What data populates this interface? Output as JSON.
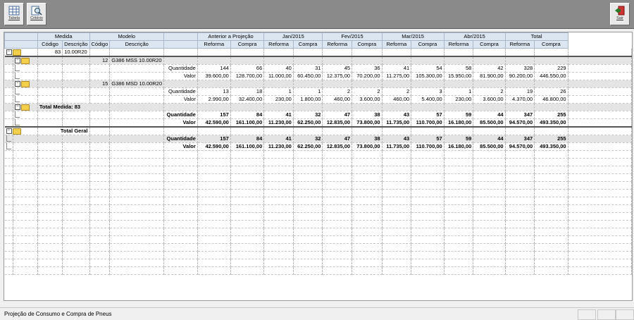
{
  "toolbar": {
    "tabela_label": "Tabela",
    "criterio_label": "Critério",
    "sair_label": "Sair"
  },
  "status": {
    "text": "Projeção de Consumo e Compra de Pneus"
  },
  "header": {
    "medida": "Medida",
    "modelo": "Modelo",
    "anterior": "Anterior a Projeção",
    "jan": "Jan/2015",
    "fev": "Fev/2015",
    "mar": "Mar/2015",
    "abr": "Abr/2015",
    "total": "Total",
    "codigo": "Código",
    "descricao": "Descrição",
    "reforma": "Reforma",
    "compra": "Compra"
  },
  "medida": {
    "codigo": "83",
    "descricao": "10.00R20"
  },
  "models": [
    {
      "codigo": "12",
      "descricao": "G386 MSS 10.00R20",
      "q": [
        "144",
        "66",
        "40",
        "31",
        "45",
        "36",
        "41",
        "54",
        "58",
        "42",
        "328",
        "229"
      ],
      "v": [
        "39.600,00",
        "128.700,00",
        "11.000,00",
        "60.450,00",
        "12.375,00",
        "70.200,00",
        "11.275,00",
        "105.300,00",
        "15.950,00",
        "81.900,00",
        "90.200,00",
        "446.550,00"
      ]
    },
    {
      "codigo": "15",
      "descricao": "G386 MSD 10.00R20",
      "q": [
        "13",
        "18",
        "1",
        "1",
        "2",
        "2",
        "2",
        "3",
        "1",
        "2",
        "19",
        "26"
      ],
      "v": [
        "2.990,00",
        "32.400,00",
        "230,00",
        "1.800,00",
        "460,00",
        "3.600,00",
        "460,00",
        "5.400,00",
        "230,00",
        "3.600,00",
        "4.370,00",
        "46.800,00"
      ]
    }
  ],
  "labels": {
    "quantidade": "Quantidade",
    "valor": "Valor",
    "total_medida": "Total Medida: 83",
    "total_geral": "Total Geral"
  },
  "total_medida": {
    "q": [
      "157",
      "84",
      "41",
      "32",
      "47",
      "38",
      "43",
      "57",
      "59",
      "44",
      "347",
      "255"
    ],
    "v": [
      "42.590,00",
      "161.100,00",
      "11.230,00",
      "62.250,00",
      "12.835,00",
      "73.800,00",
      "11.735,00",
      "110.700,00",
      "16.180,00",
      "85.500,00",
      "94.570,00",
      "493.350,00"
    ]
  },
  "total_geral": {
    "q": [
      "157",
      "84",
      "41",
      "32",
      "47",
      "38",
      "43",
      "57",
      "59",
      "44",
      "347",
      "255"
    ],
    "v": [
      "42.590,00",
      "161.100,00",
      "11.230,00",
      "62.250,00",
      "12.835,00",
      "73.800,00",
      "11.735,00",
      "110.700,00",
      "16.180,00",
      "85.500,00",
      "94.570,00",
      "493.350,00"
    ]
  }
}
